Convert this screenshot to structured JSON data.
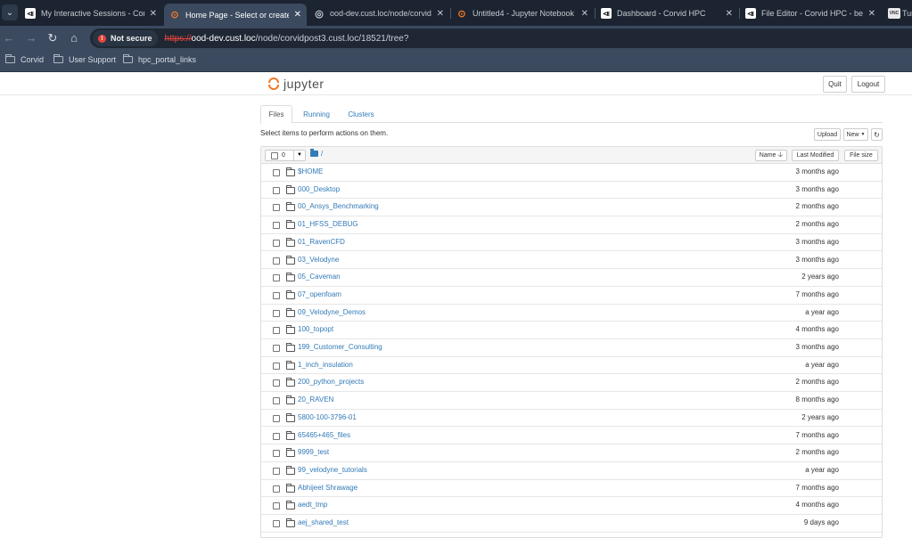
{
  "browser": {
    "tabs": [
      {
        "title": "My Interactive Sessions - Corvid",
        "favicon": "corvid-icon"
      },
      {
        "title": "Home Page - Select or create a",
        "favicon": "jupyter-icon"
      },
      {
        "title": "ood-dev.cust.loc/node/corvidp",
        "favicon": "globe-icon"
      },
      {
        "title": "Untitled4 - Jupyter Notebook",
        "favicon": "jupyter-icon"
      },
      {
        "title": "Dashboard - Corvid HPC",
        "favicon": "corvid-icon"
      },
      {
        "title": "File Editor - Corvid HPC - befor",
        "favicon": "corvid-icon"
      },
      {
        "title": "Tur",
        "favicon": "vnc-icon"
      }
    ],
    "vnc_favicon_text": "VNC",
    "security_label": "Not secure",
    "url_scheme": "https://",
    "url_host": "ood-dev.cust.loc",
    "url_path": "/node/corvidpost3.cust.loc/18521/tree?",
    "bookmarks": [
      "Corvid",
      "User Support",
      "hpc_portal_links"
    ]
  },
  "jupyter": {
    "logo_text": "jupyter",
    "quit_label": "Quit",
    "logout_label": "Logout",
    "tabs": [
      "Files",
      "Running",
      "Clusters"
    ],
    "instructions": "Select items to perform actions on them.",
    "upload_label": "Upload",
    "new_label": "New",
    "selected_count": "0",
    "breadcrumb": "/",
    "sort_name_label": "Name",
    "last_modified_label": "Last Modified",
    "file_size_label": "File size",
    "files": [
      {
        "name": "$HOME",
        "modified": "3 months ago"
      },
      {
        "name": "000_Desktop",
        "modified": "3 months ago"
      },
      {
        "name": "00_Ansys_Benchmarking",
        "modified": "2 months ago"
      },
      {
        "name": "01_HFSS_DEBUG",
        "modified": "2 months ago"
      },
      {
        "name": "01_RavenCFD",
        "modified": "3 months ago"
      },
      {
        "name": "03_Velodyne",
        "modified": "3 months ago"
      },
      {
        "name": "05_Caveman",
        "modified": "2 years ago"
      },
      {
        "name": "07_openfoam",
        "modified": "7 months ago"
      },
      {
        "name": "09_Velodyne_Demos",
        "modified": "a year ago"
      },
      {
        "name": "100_topopt",
        "modified": "4 months ago"
      },
      {
        "name": "199_Customer_Consulting",
        "modified": "3 months ago"
      },
      {
        "name": "1_inch_insulation",
        "modified": "a year ago"
      },
      {
        "name": "200_python_projects",
        "modified": "2 months ago"
      },
      {
        "name": "20_RAVEN",
        "modified": "8 months ago"
      },
      {
        "name": "5800-100-3796-01",
        "modified": "2 years ago"
      },
      {
        "name": "65465+465_files",
        "modified": "7 months ago"
      },
      {
        "name": "9999_test",
        "modified": "2 months ago"
      },
      {
        "name": "99_velodyne_tutorials",
        "modified": "a year ago"
      },
      {
        "name": "Abhijeet Shrawage",
        "modified": "7 months ago"
      },
      {
        "name": "aedt_tmp",
        "modified": "4 months ago"
      },
      {
        "name": "aej_shared_test",
        "modified": "9 days ago"
      }
    ]
  }
}
